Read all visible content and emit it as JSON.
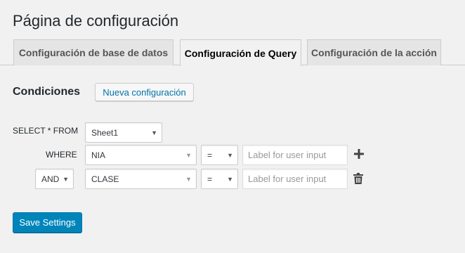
{
  "page": {
    "title": "Página de configuración"
  },
  "tabs": [
    {
      "label": "Configuración de base de datos",
      "active": false
    },
    {
      "label": "Configuración de Query",
      "active": true
    },
    {
      "label": "Configuración de la acción",
      "active": false
    }
  ],
  "conditions": {
    "heading": "Condiciones",
    "new_button": "Nueva configuración"
  },
  "query": {
    "select_from_label": "SELECT * FROM",
    "table": "Sheet1",
    "where_label": "WHERE",
    "rows": [
      {
        "field": "NIA",
        "operator": "=",
        "placeholder": "Label for user input"
      },
      {
        "connector": "AND",
        "field": "CLASE",
        "operator": "=",
        "placeholder": "Label for user input"
      }
    ]
  },
  "icons": {
    "add": "plus-icon",
    "delete": "trash-icon",
    "dropdown": "caret-down-icon"
  },
  "footer": {
    "save_label": "Save Settings"
  },
  "colors": {
    "primary": "#0085ba",
    "link": "#0073aa",
    "background": "#f1f1f1"
  }
}
